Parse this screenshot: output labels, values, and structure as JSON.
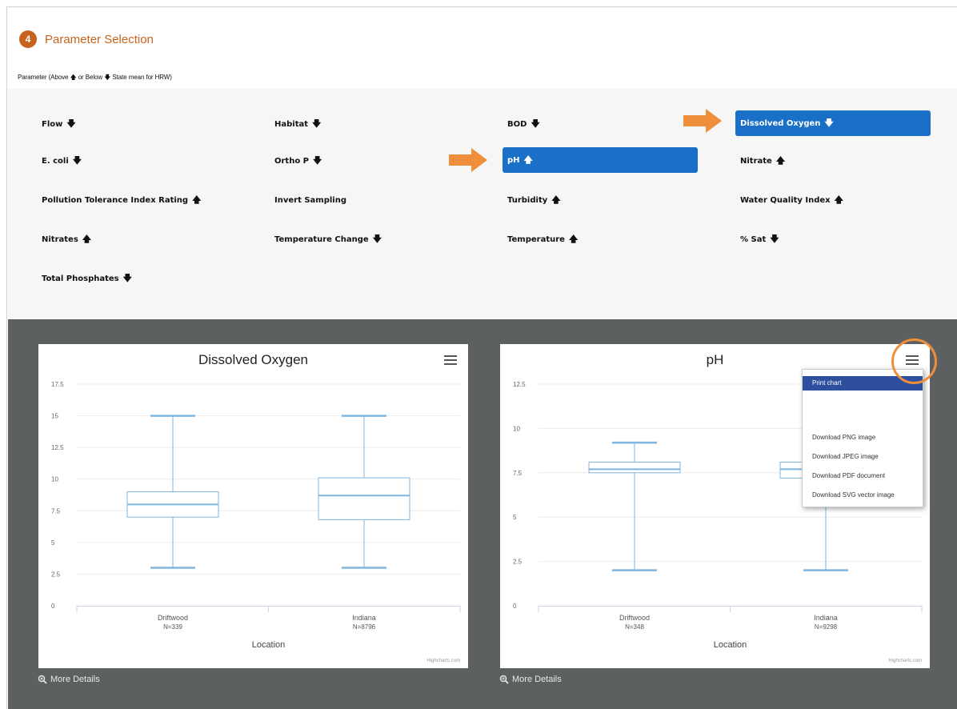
{
  "step": {
    "number": "4",
    "title": "Parameter Selection"
  },
  "param_caption": {
    "prefix": "Parameter (Above",
    "middle": "or Below",
    "suffix": "State mean for HRW)"
  },
  "params": [
    {
      "label": "Flow",
      "dir": "down",
      "selected": false
    },
    {
      "label": "Habitat",
      "dir": "down",
      "selected": false
    },
    {
      "label": "BOD",
      "dir": "down",
      "selected": false
    },
    {
      "label": "Dissolved Oxygen",
      "dir": "down",
      "selected": true
    },
    {
      "label": "E. coli",
      "dir": "down",
      "selected": false
    },
    {
      "label": "Ortho P",
      "dir": "down",
      "selected": false
    },
    {
      "label": "pH",
      "dir": "up",
      "selected": true
    },
    {
      "label": "Nitrate",
      "dir": "up",
      "selected": false
    },
    {
      "label": "Pollution Tolerance Index Rating",
      "dir": "up",
      "selected": false
    },
    {
      "label": "Invert Sampling",
      "dir": "none",
      "selected": false
    },
    {
      "label": "Turbidity",
      "dir": "up",
      "selected": false
    },
    {
      "label": "Water Quality Index",
      "dir": "up",
      "selected": false
    },
    {
      "label": "Nitrates",
      "dir": "up",
      "selected": false
    },
    {
      "label": "Temperature Change",
      "dir": "down",
      "selected": false
    },
    {
      "label": "Temperature",
      "dir": "up",
      "selected": false
    },
    {
      "label": "% Sat",
      "dir": "down",
      "selected": false
    },
    {
      "label": "Total Phosphates",
      "dir": "down",
      "selected": false
    }
  ],
  "arrows": {
    "up": "🡅",
    "down": "🡇"
  },
  "colors": {
    "accent": "#c8631d",
    "selected": "#1a6fc7",
    "box": "#7fb6e0",
    "highlight": "#ef8f3c"
  },
  "chart_data": [
    {
      "type": "boxplot",
      "title": "Dissolved Oxygen",
      "xlabel": "Location",
      "ylabel": "",
      "ylim": [
        0,
        17.5
      ],
      "yticks": [
        "0",
        "2.5",
        "5",
        "7.5",
        "10",
        "12.5",
        "15",
        "17.5"
      ],
      "categories": [
        "Driftwood",
        "Indiana"
      ],
      "counts": [
        "N=339",
        "N=8796"
      ],
      "boxes": [
        {
          "low": 3.0,
          "q1": 7.0,
          "median": 8.0,
          "q3": 9.0,
          "high": 15.0
        },
        {
          "low": 3.0,
          "q1": 6.8,
          "median": 8.7,
          "q3": 10.1,
          "high": 15.0
        }
      ],
      "credits": "Highcharts.com"
    },
    {
      "type": "boxplot",
      "title": "pH",
      "xlabel": "Location",
      "ylabel": "",
      "ylim": [
        0,
        12.5
      ],
      "yticks": [
        "0",
        "2.5",
        "5",
        "7.5",
        "10",
        "12.5"
      ],
      "categories": [
        "Driftwood",
        "Indiana"
      ],
      "counts": [
        "N=348",
        "N=9298"
      ],
      "boxes": [
        {
          "low": 2.0,
          "q1": 7.5,
          "median": 7.7,
          "q3": 8.1,
          "high": 9.2
        },
        {
          "low": 2.0,
          "q1": 7.2,
          "median": 7.7,
          "q3": 8.1,
          "high": 9.2
        }
      ],
      "credits": "Highcharts.com"
    }
  ],
  "more_details": "More Details",
  "export_menu": {
    "items": [
      "Print chart",
      "Download PNG image",
      "Download JPEG image",
      "Download PDF document",
      "Download SVG vector image"
    ]
  }
}
